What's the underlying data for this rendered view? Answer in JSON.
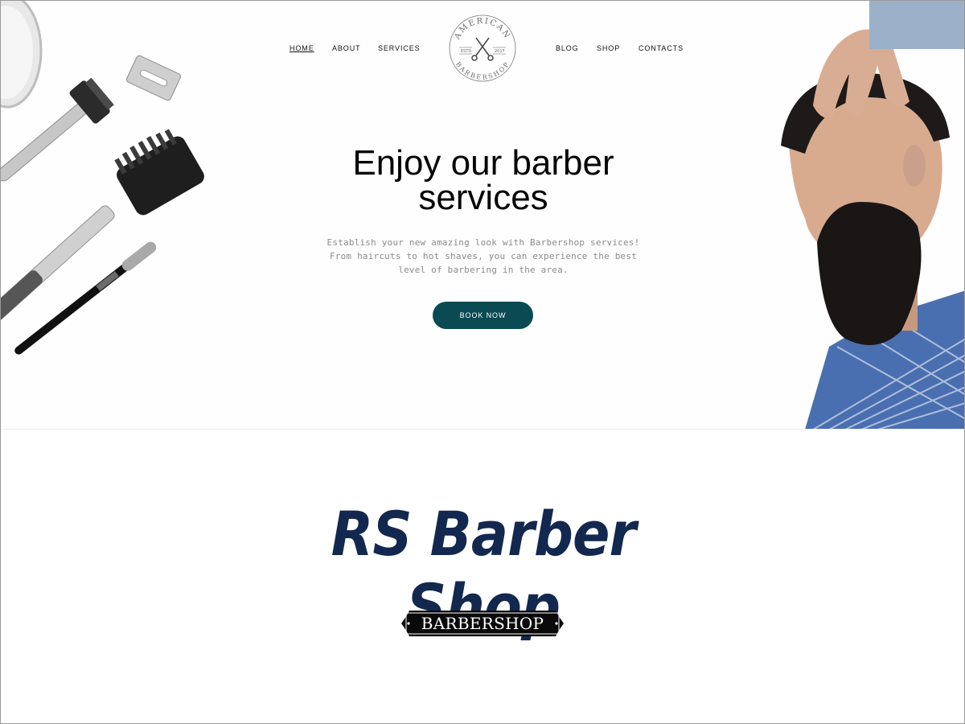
{
  "nav": {
    "left": [
      {
        "label": "HOME",
        "active": true
      },
      {
        "label": "ABOUT",
        "active": false
      },
      {
        "label": "SERVICES",
        "active": false
      }
    ],
    "right": [
      {
        "label": "BLOG",
        "active": false
      },
      {
        "label": "SHOP",
        "active": false
      },
      {
        "label": "CONTACTS",
        "active": false
      }
    ]
  },
  "logo": {
    "top_text": "AMERICAN",
    "bottom_text": "BARBERSHOP",
    "estd": "ESTD.",
    "year": "2017",
    "icon": "scissors-icon"
  },
  "hero": {
    "title_line1": "Enjoy our barber",
    "title_line2": "services",
    "subtitle": "Establish your new amazing look with Barbershop services! From haircuts to hot shaves, you can experience the best level of barbering in the area.",
    "cta_label": "BOOK NOW"
  },
  "section": {
    "title": "RS Barber Shop",
    "badge_text": "BARBERSHOP"
  },
  "colors": {
    "accent": "#0a4a52",
    "title_navy": "#13284f",
    "badge_bg": "#0a0a0a"
  }
}
